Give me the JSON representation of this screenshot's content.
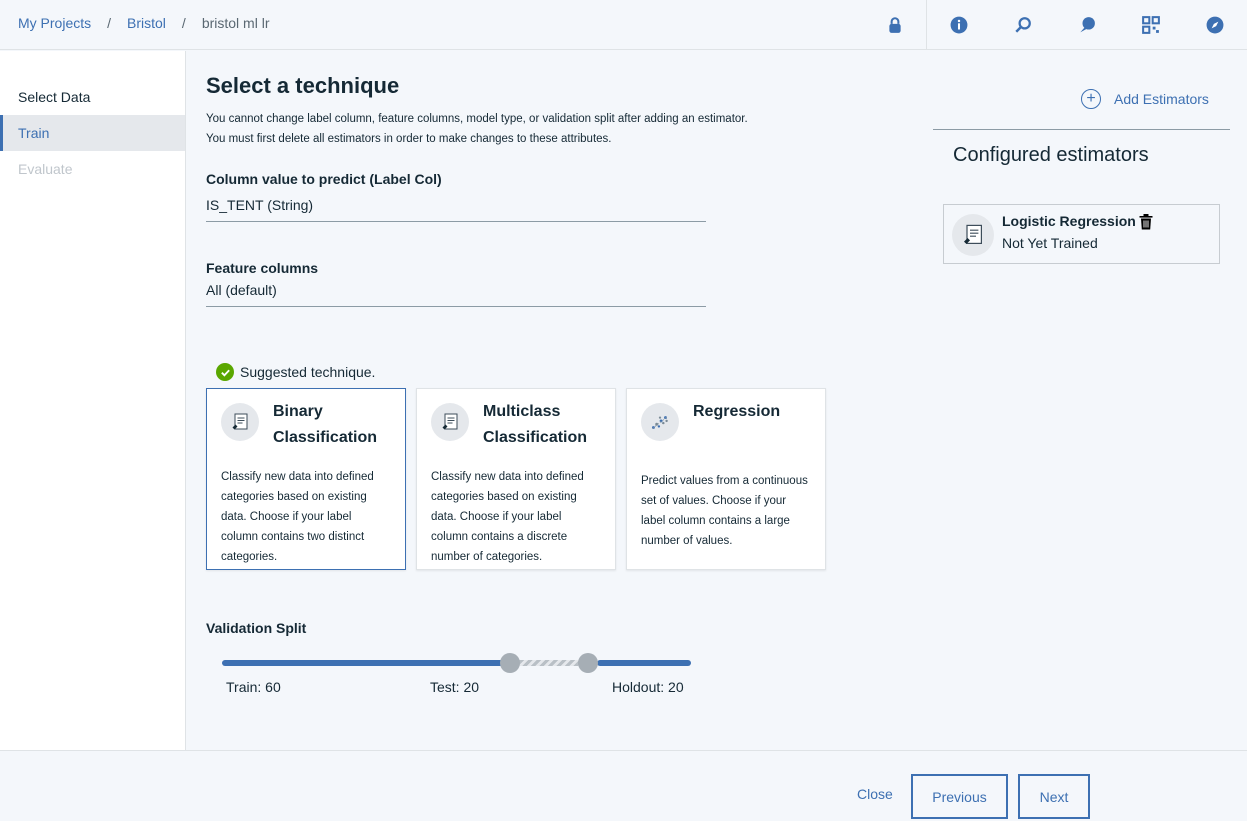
{
  "breadcrumb": {
    "items": [
      "My Projects",
      "Bristol"
    ],
    "current": "bristol ml lr",
    "separator": "/"
  },
  "header_icons": [
    "lock-icon",
    "info-icon",
    "zoom-icon",
    "chat-icon",
    "grid-icon",
    "compass-icon"
  ],
  "sidebar": {
    "items": [
      {
        "label": "Select Data",
        "state": "normal"
      },
      {
        "label": "Train",
        "state": "active"
      },
      {
        "label": "Evaluate",
        "state": "disabled"
      }
    ]
  },
  "main": {
    "title": "Select a technique",
    "description_lines": [
      "You cannot change label column, feature columns, model type, or validation split after adding an estimator.",
      "You must first delete all estimators in order to make changes to these attributes."
    ],
    "label_col": {
      "label": "Column value to predict (Label Col)",
      "value": "IS_TENT (String)"
    },
    "feature_cols": {
      "label": "Feature columns",
      "value": "All (default)"
    },
    "suggested": "Suggested technique.",
    "techniques": [
      {
        "title_line1": "Binary",
        "title_line2": "Classification",
        "selected": true,
        "desc": "Classify new data into defined categories based on existing data. Choose if your label column contains two distinct categories."
      },
      {
        "title_line1": "Multiclass",
        "title_line2": "Classification",
        "selected": false,
        "desc": "Classify new data into defined categories based on existing data. Choose if your label column contains a discrete number of categories."
      },
      {
        "title_line1": "Regression",
        "title_line2": "",
        "selected": false,
        "desc": "Predict values from a continuous set of values. Choose if your label column contains a large number of values."
      }
    ],
    "validation": {
      "label": "Validation Split",
      "train_label": "Train: 60",
      "test_label": "Test: 20",
      "holdout_label": "Holdout: 20",
      "train": 60,
      "test": 20,
      "holdout": 20
    }
  },
  "right_panel": {
    "add_label": "Add Estimators",
    "configured_title": "Configured estimators",
    "estimator": {
      "name": "Logistic Regression",
      "status": "Not Yet Trained"
    }
  },
  "footer": {
    "close": "Close",
    "previous": "Previous",
    "next": "Next"
  },
  "colors": {
    "accent": "#3d70b2",
    "success": "#5aa700",
    "text": "#152935"
  }
}
